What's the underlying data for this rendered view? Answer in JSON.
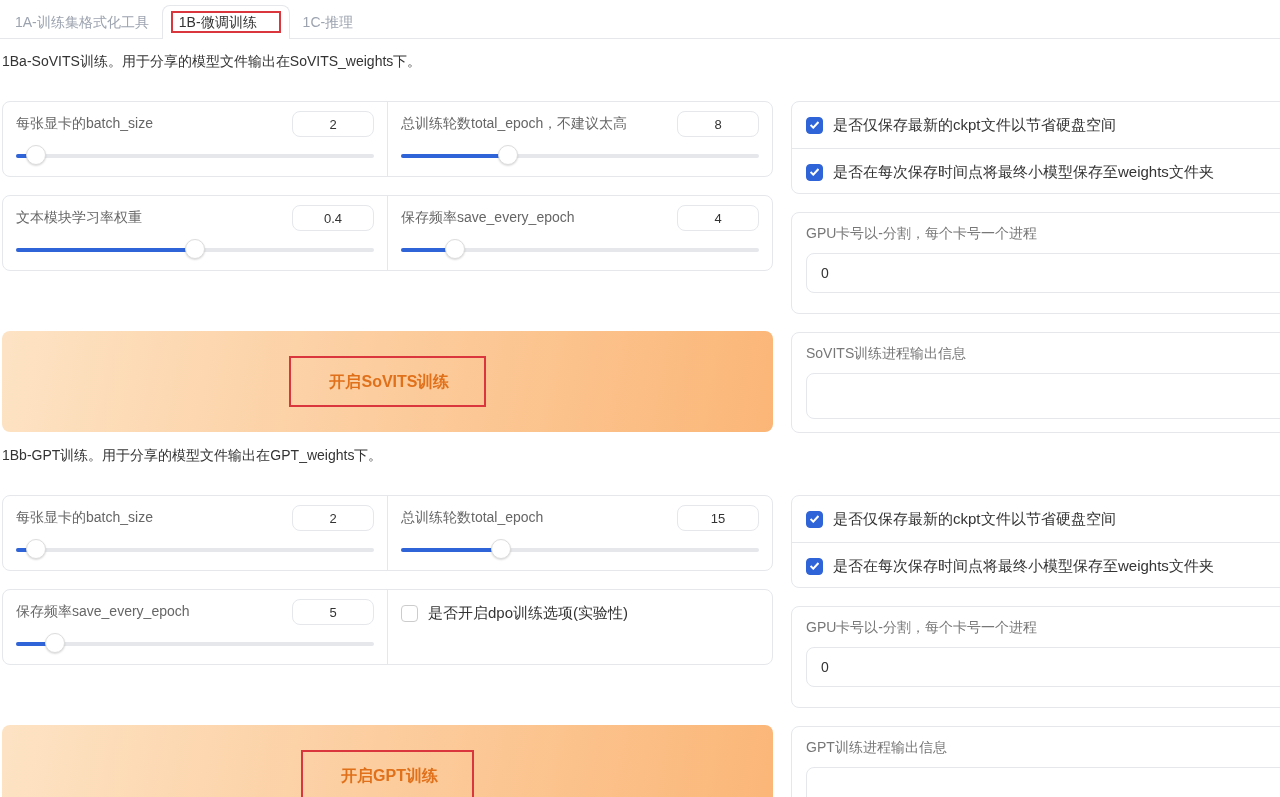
{
  "tabs": [
    {
      "label": "1A-训练集格式化工具",
      "selected": false,
      "highlighted": false
    },
    {
      "label": "1B-微调训练",
      "selected": true,
      "highlighted": true
    },
    {
      "label": "1C-推理",
      "selected": false,
      "highlighted": false
    }
  ],
  "sections": [
    {
      "heading": "1Ba-SoVITS训练。用于分享的模型文件输出在SoVITS_weights下。",
      "panels": [
        [
          {
            "kind": "slider",
            "label": "每张显卡的batch_size",
            "value": "2",
            "level": 0.055
          },
          {
            "kind": "slider",
            "label": "总训练轮数total_epoch，不建议太高",
            "value": "8",
            "level": 0.3
          }
        ],
        [
          {
            "kind": "slider",
            "label": "文本模块学习率权重",
            "value": "0.4",
            "level": 0.5
          },
          {
            "kind": "slider",
            "label": "保存频率save_every_epoch",
            "value": "4",
            "level": 0.15
          }
        ]
      ],
      "checkboxes": [
        {
          "label": "是否仅保存最新的ckpt文件以节省硬盘空间",
          "checked": true
        },
        {
          "label": "是否在每次保存时间点将最终小模型保存至weights文件夹",
          "checked": true
        }
      ],
      "gpu_field": {
        "label": "GPU卡号以-分割，每个卡号一个进程",
        "value": "0"
      },
      "button": {
        "label": "开启SoVITS训练",
        "highlighted": true
      },
      "output": {
        "label": "SoVITS训练进程输出信息"
      }
    },
    {
      "heading": "1Bb-GPT训练。用于分享的模型文件输出在GPT_weights下。",
      "panels": [
        [
          {
            "kind": "slider",
            "label": "每张显卡的batch_size",
            "value": "2",
            "level": 0.055
          },
          {
            "kind": "slider",
            "label": "总训练轮数total_epoch",
            "value": "15",
            "level": 0.28
          }
        ],
        [
          {
            "kind": "slider",
            "label": "保存频率save_every_epoch",
            "value": "5",
            "level": 0.11
          },
          {
            "kind": "checkbox",
            "label": "是否开启dpo训练选项(实验性)",
            "checked": false
          }
        ]
      ],
      "checkboxes": [
        {
          "label": "是否仅保存最新的ckpt文件以节省硬盘空间",
          "checked": true
        },
        {
          "label": "是否在每次保存时间点将最终小模型保存至weights文件夹",
          "checked": true
        }
      ],
      "gpu_field": {
        "label": "GPU卡号以-分割，每个卡号一个进程",
        "value": "0"
      },
      "button": {
        "label": "开启GPT训练",
        "highlighted": true
      },
      "output": {
        "label": "GPT训练进程输出信息"
      }
    }
  ]
}
